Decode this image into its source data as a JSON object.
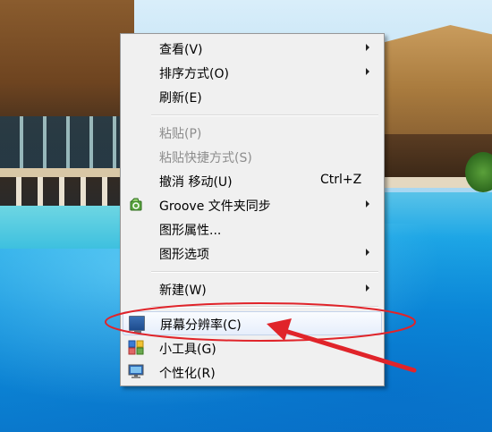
{
  "desktop": {
    "wallpaper": "resort-pool-wallpaper"
  },
  "context_menu": {
    "items": [
      {
        "label": "查看(V)",
        "has_submenu": true,
        "enabled": true
      },
      {
        "label": "排序方式(O)",
        "has_submenu": true,
        "enabled": true
      },
      {
        "label": "刷新(E)",
        "has_submenu": false,
        "enabled": true
      },
      {
        "label": "粘贴(P)",
        "has_submenu": false,
        "enabled": false
      },
      {
        "label": "粘贴快捷方式(S)",
        "has_submenu": false,
        "enabled": false
      },
      {
        "label": "撤消 移动(U)",
        "shortcut": "Ctrl+Z",
        "has_submenu": false,
        "enabled": true
      },
      {
        "label": "Groove 文件夹同步",
        "has_submenu": true,
        "enabled": true,
        "icon": "groove-sync-icon"
      },
      {
        "label": "图形属性...",
        "has_submenu": false,
        "enabled": true
      },
      {
        "label": "图形选项",
        "has_submenu": true,
        "enabled": true
      },
      {
        "label": "新建(W)",
        "has_submenu": true,
        "enabled": true
      },
      {
        "label": "屏幕分辨率(C)",
        "has_submenu": false,
        "enabled": true,
        "icon": "screen-resolution-icon",
        "highlighted": true
      },
      {
        "label": "小工具(G)",
        "has_submenu": false,
        "enabled": true,
        "icon": "gadgets-icon"
      },
      {
        "label": "个性化(R)",
        "has_submenu": false,
        "enabled": true,
        "icon": "personalize-icon"
      }
    ]
  },
  "annotation": {
    "color": "#e0242a",
    "target": "屏幕分辨率(C)"
  }
}
